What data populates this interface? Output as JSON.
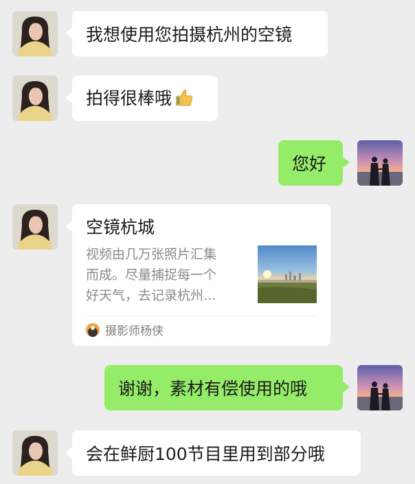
{
  "messages": [
    {
      "side": "left",
      "text": "我想使用您拍摄杭州的空镜"
    },
    {
      "side": "left",
      "text": "拍得很棒哦"
    },
    {
      "side": "right",
      "text": "您好"
    },
    {
      "side": "left",
      "card": {
        "title": "空镜杭城",
        "desc_lines": [
          "视频由几万张照片汇集",
          "而成。尽量捕捉每一个",
          "好天气，去记录杭州..."
        ],
        "source": "摄影师杨侠",
        "thumb_icon": "city-skyline-thumbnail",
        "source_icon": "avatar-icon"
      }
    },
    {
      "side": "right",
      "text": "谢谢，素材有偿使用的哦"
    },
    {
      "side": "left",
      "text": "会在鲜厨100节目里用到部分哦"
    }
  ],
  "icons": {
    "thumbs_up": "thumbs-up-emoji"
  },
  "colors": {
    "background": "#ededed",
    "incoming": "#ffffff",
    "outgoing": "#95ec69"
  }
}
